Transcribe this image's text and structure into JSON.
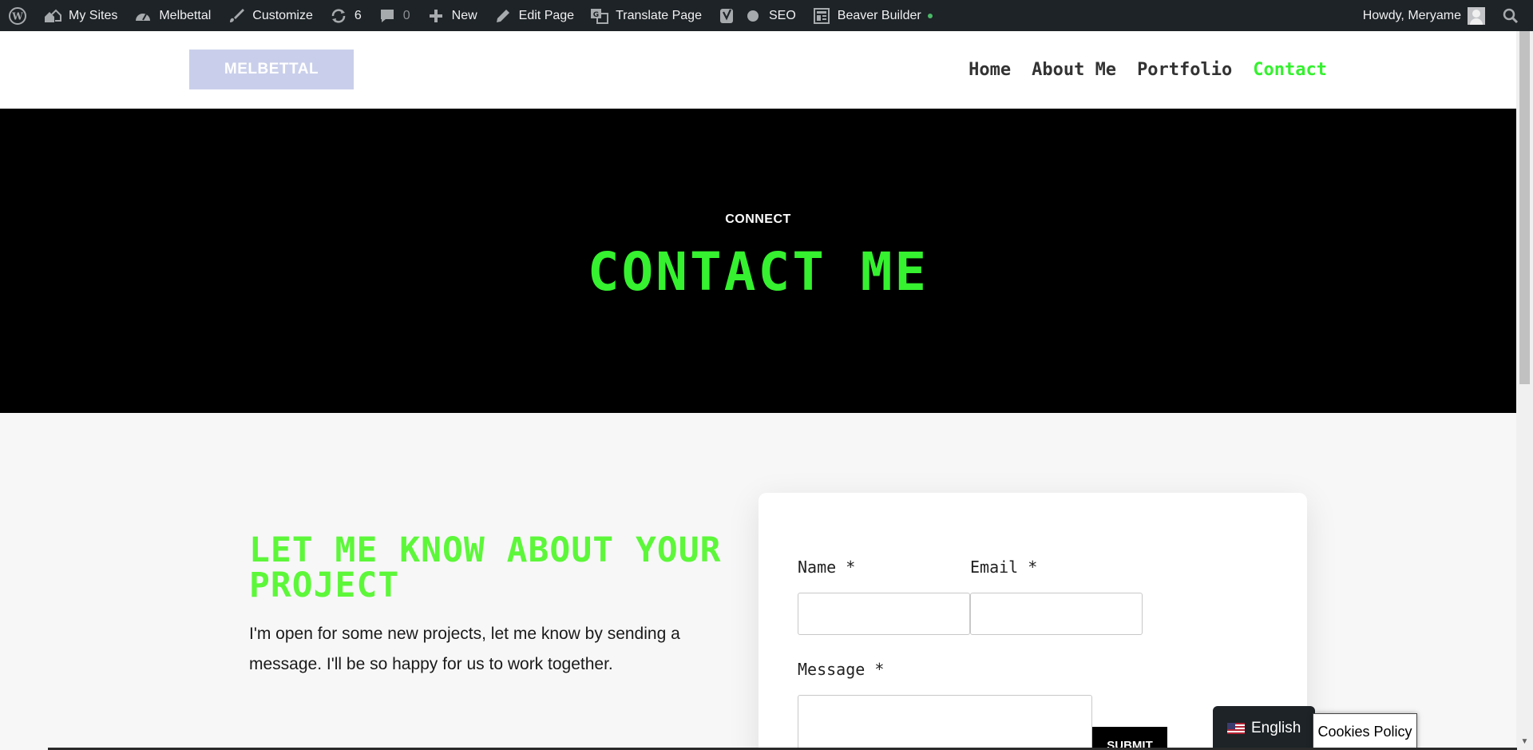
{
  "admin_bar": {
    "my_sites": "My Sites",
    "site_name": "Melbettal",
    "customize": "Customize",
    "updates_count": "6",
    "comments_count": "0",
    "new": "New",
    "edit_page": "Edit Page",
    "translate_page": "Translate Page",
    "seo": "SEO",
    "beaver_builder": "Beaver Builder",
    "howdy": "Howdy, Meryame"
  },
  "header": {
    "logo_text": "MELBETTAL",
    "nav": [
      {
        "label": "Home",
        "active": false
      },
      {
        "label": "About Me",
        "active": false
      },
      {
        "label": "Portfolio",
        "active": false
      },
      {
        "label": "Contact",
        "active": true
      }
    ]
  },
  "hero": {
    "kicker": "CONNECT",
    "title": "CONTACT ME"
  },
  "content": {
    "heading": "LET ME KNOW ABOUT YOUR PROJECT",
    "paragraph": "I'm open for some new projects, let me know by sending a message. I'll be so happy for us to work together."
  },
  "form": {
    "name_label": "Name *",
    "email_label": "Email *",
    "message_label": "Message *",
    "submit_label": "SUBMIT"
  },
  "language_switcher": {
    "label": "English"
  },
  "cookies": {
    "label": "Cookies Policy"
  },
  "colors": {
    "accent_green": "#35f12f",
    "admin_bar_bg": "#1d2327",
    "logo_bg": "#c9cfea"
  }
}
